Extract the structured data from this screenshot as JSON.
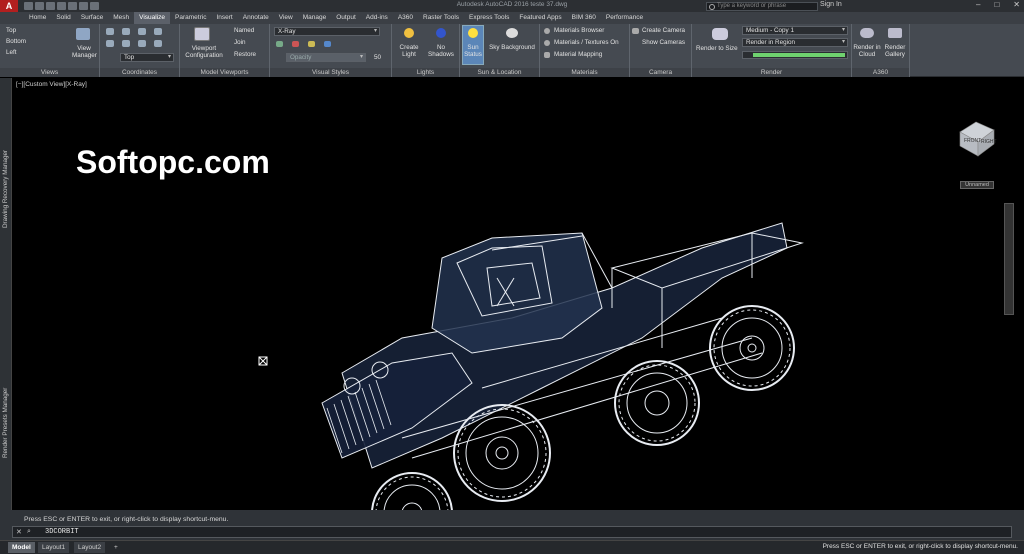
{
  "title_bar": {
    "app_button": "A",
    "document_title": "Autodesk AutoCAD 2016   teste 37.dwg",
    "search_placeholder": "Type a keyword or phrase",
    "signin": "Sign In",
    "controls": [
      "–",
      "□",
      "✕"
    ]
  },
  "tabs": [
    "Home",
    "Solid",
    "Surface",
    "Mesh",
    "Visualize",
    "Parametric",
    "Insert",
    "Annotate",
    "View",
    "Manage",
    "Output",
    "Add-ins",
    "A360",
    "Raster Tools",
    "Express Tools",
    "Featured Apps",
    "BIM 360",
    "Performance"
  ],
  "active_tab": "Visualize",
  "ribbon": {
    "views": {
      "title": "Views",
      "items": [
        "Top",
        "Bottom",
        "Left"
      ],
      "manager": "View Manager"
    },
    "coordinates": {
      "title": "Coordinates",
      "ucs_value": "Top"
    },
    "model_viewports": {
      "title": "Model Viewports",
      "config": "Viewport Configuration",
      "named": "Named",
      "join": "Join",
      "restore": "Restore"
    },
    "visual_styles": {
      "title": "Visual Styles",
      "style": "X-Ray",
      "opacity_placeholder": "Opacity",
      "opacity_value": "50"
    },
    "lights": {
      "title": "Lights",
      "create": "Create Light",
      "no_shadows": "No Shadows"
    },
    "sun_location": {
      "title": "Sun & Location",
      "sun_status": "Sun Status",
      "sky": "Sky Background"
    },
    "materials": {
      "title": "Materials",
      "browser": "Materials Browser",
      "textures": "Materials / Textures On",
      "mapping": "Material Mapping"
    },
    "camera": {
      "title": "Camera",
      "create": "Create Camera",
      "show": "Show Cameras"
    },
    "render": {
      "title": "Render",
      "render_to_size": "Render to Size",
      "preset": "Medium - Copy 1",
      "region": "Render in Region"
    },
    "a360": {
      "title": "A360",
      "cloud": "Render in Cloud",
      "gallery": "Render Gallery"
    }
  },
  "viewport": {
    "label": "[−][Custom View][X-Ray]",
    "watermark": "Softopc.com",
    "viewcube_top": "FRONT",
    "viewcube_side": "RIGHT",
    "wcs": "Unnamed"
  },
  "side_panels": [
    "Drawing Recovery Manager",
    "Render Presets Manager"
  ],
  "command": {
    "history": "Press ESC or ENTER to exit, or right-click to display shortcut-menu.",
    "current": "3DCORBIT"
  },
  "layout_tabs": [
    "Model",
    "Layout1",
    "Layout2",
    "+"
  ],
  "status_message": "Press ESC or ENTER to exit, or right-click to display shortcut-menu.",
  "colors": {
    "ribbon": "#454a51",
    "tab_bar": "#3b3f45",
    "active_tab": "#5b6069",
    "wireframe": "#e8ecf2",
    "body_tint": "#1c2a44",
    "app_red": "#b21f1f"
  }
}
